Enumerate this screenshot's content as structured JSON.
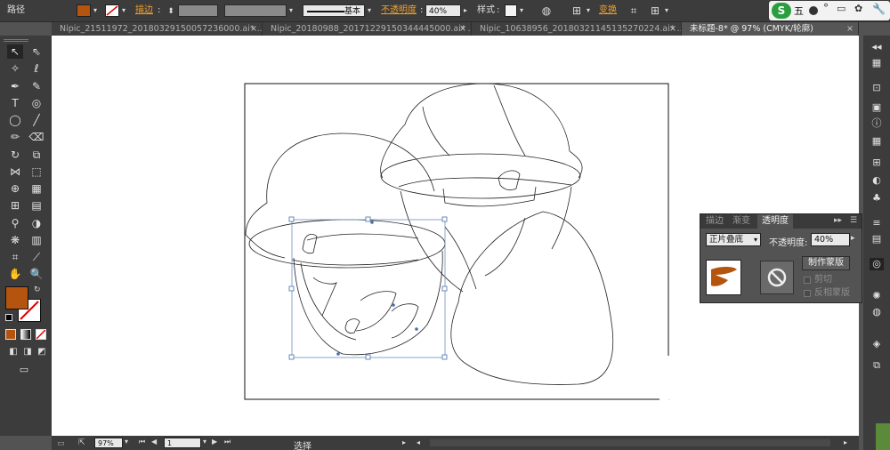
{
  "control_bar": {
    "object_type": "路径",
    "stroke_label": "描边",
    "stroke_profile_label": "基本",
    "opacity_label": "不透明度",
    "opacity_value": "40%",
    "style_label": "样式",
    "transform_label": "变换",
    "fill_color": "#b5540f",
    "ime": {
      "status_label": "五"
    }
  },
  "tabs": [
    {
      "label": "Nipic_21511972_20180329150057236000.ai* ...",
      "close": "×"
    },
    {
      "label": "Nipic_20180988_20171229150344445000.ai* ...",
      "close": "×"
    },
    {
      "label": "Nipic_10638956_20180321145135270224.ai* ...",
      "close": "×"
    },
    {
      "label": "未标题-8* @ 97% (CMYK/轮廓)",
      "close": "×",
      "active": true
    }
  ],
  "transparency_panel": {
    "tabs": [
      "描边",
      "渐变",
      "透明度"
    ],
    "blend_mode": "正片叠底",
    "opacity_label": "不透明度:",
    "opacity_value": "40%",
    "make_mask_label": "制作蒙版",
    "clip_label": "剪切",
    "invert_mask_label": "反相蒙版"
  },
  "status_bar": {
    "zoom": "97%",
    "page": "1",
    "tool_status": "选择"
  },
  "colors": {
    "fill": "#b5540f",
    "ui_dark": "#3c3c3c",
    "ui_mid": "#535353",
    "accent_orange": "#f0a030"
  }
}
